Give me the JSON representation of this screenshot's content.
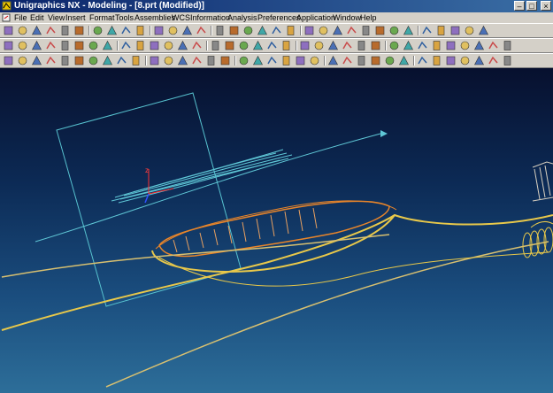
{
  "window": {
    "title": "Unigraphics NX - Modeling - [8.prt (Modified)]",
    "controls": [
      "minimize",
      "maximize",
      "close"
    ]
  },
  "menu": {
    "items": [
      "File",
      "Edit",
      "View",
      "Insert",
      "Format",
      "Tools",
      "Assemblies",
      "WCS",
      "Information",
      "Analysis",
      "Preferences",
      "Application",
      "Window",
      "Help"
    ]
  },
  "toolbars": {
    "row1": [
      "new-icon",
      "open-icon",
      "save-icon",
      "print-icon",
      "cut-icon",
      "copy-icon",
      "paste-icon",
      "delete-icon",
      "undo-icon",
      "measure-icon",
      "sketch-icon",
      "layer-icon",
      "view-icon",
      "fit-icon",
      "zoom-icon",
      "rotate-icon",
      "pan-icon",
      "refresh-icon",
      "render-icon",
      "shade-icon",
      "wire-icon",
      "section-icon",
      "palette-icon",
      "light-icon",
      "color-icon",
      "blank-icon",
      "unblank-icon",
      "filter-icon",
      "grid-icon",
      "analysis-icon",
      "check-icon",
      "doc-icon",
      "help-icon"
    ],
    "row2": [
      "extrude-icon",
      "revolve-icon",
      "sweep-icon",
      "hole-icon",
      "boss-icon",
      "pocket-icon",
      "pad-icon",
      "slot-icon",
      "groove-icon",
      "block-icon",
      "cylinder-icon",
      "cone-icon",
      "sphere-icon",
      "blend-icon",
      "chamfer-icon",
      "shell-icon",
      "offset-icon",
      "trim-icon",
      "split-icon",
      "unite-icon",
      "subtract-icon",
      "intersect-icon",
      "pattern-icon",
      "mirror-icon",
      "feature-icon",
      "datum-icon",
      "edit-icon",
      "param-icon",
      "suppress-icon",
      "replay-icon",
      "express-icon",
      "part-nav-icon",
      "assembly-icon",
      "drafting-icon",
      "cam-icon"
    ],
    "row3": [
      "point-icon",
      "line-icon",
      "arc-icon",
      "spline-icon",
      "plus-icon",
      "rectangle-icon",
      "polygon-icon",
      "ellipse-icon",
      "curve-icon",
      "offset-curve-icon",
      "bridge-icon",
      "project-icon",
      "intersect-curve-icon",
      "extract-icon",
      "surface-icon",
      "through-curves-icon",
      "mesh-icon",
      "swept-surface-icon",
      "sew-icon",
      "trimmed-sheet-icon",
      "fillet-surface-icon",
      "extension-icon",
      "law-icon",
      "helix-icon",
      "text-icon",
      "measure-distance-icon",
      "section-curve-icon",
      "isoparametric-icon",
      "analysis-curve-icon",
      "deviation-icon",
      "color-analysis-icon",
      "snap-icon",
      "selection-icon",
      "point-constructor-icon",
      "vector-icon"
    ]
  },
  "colors": {
    "title_bar": "#0a246a",
    "viewport_top": "#07102e",
    "viewport_bottom": "#2d6e99",
    "curve_yellow": "#e8c84a",
    "curve_orange": "#e8852a",
    "curve_cyan": "#5fc7d6"
  }
}
